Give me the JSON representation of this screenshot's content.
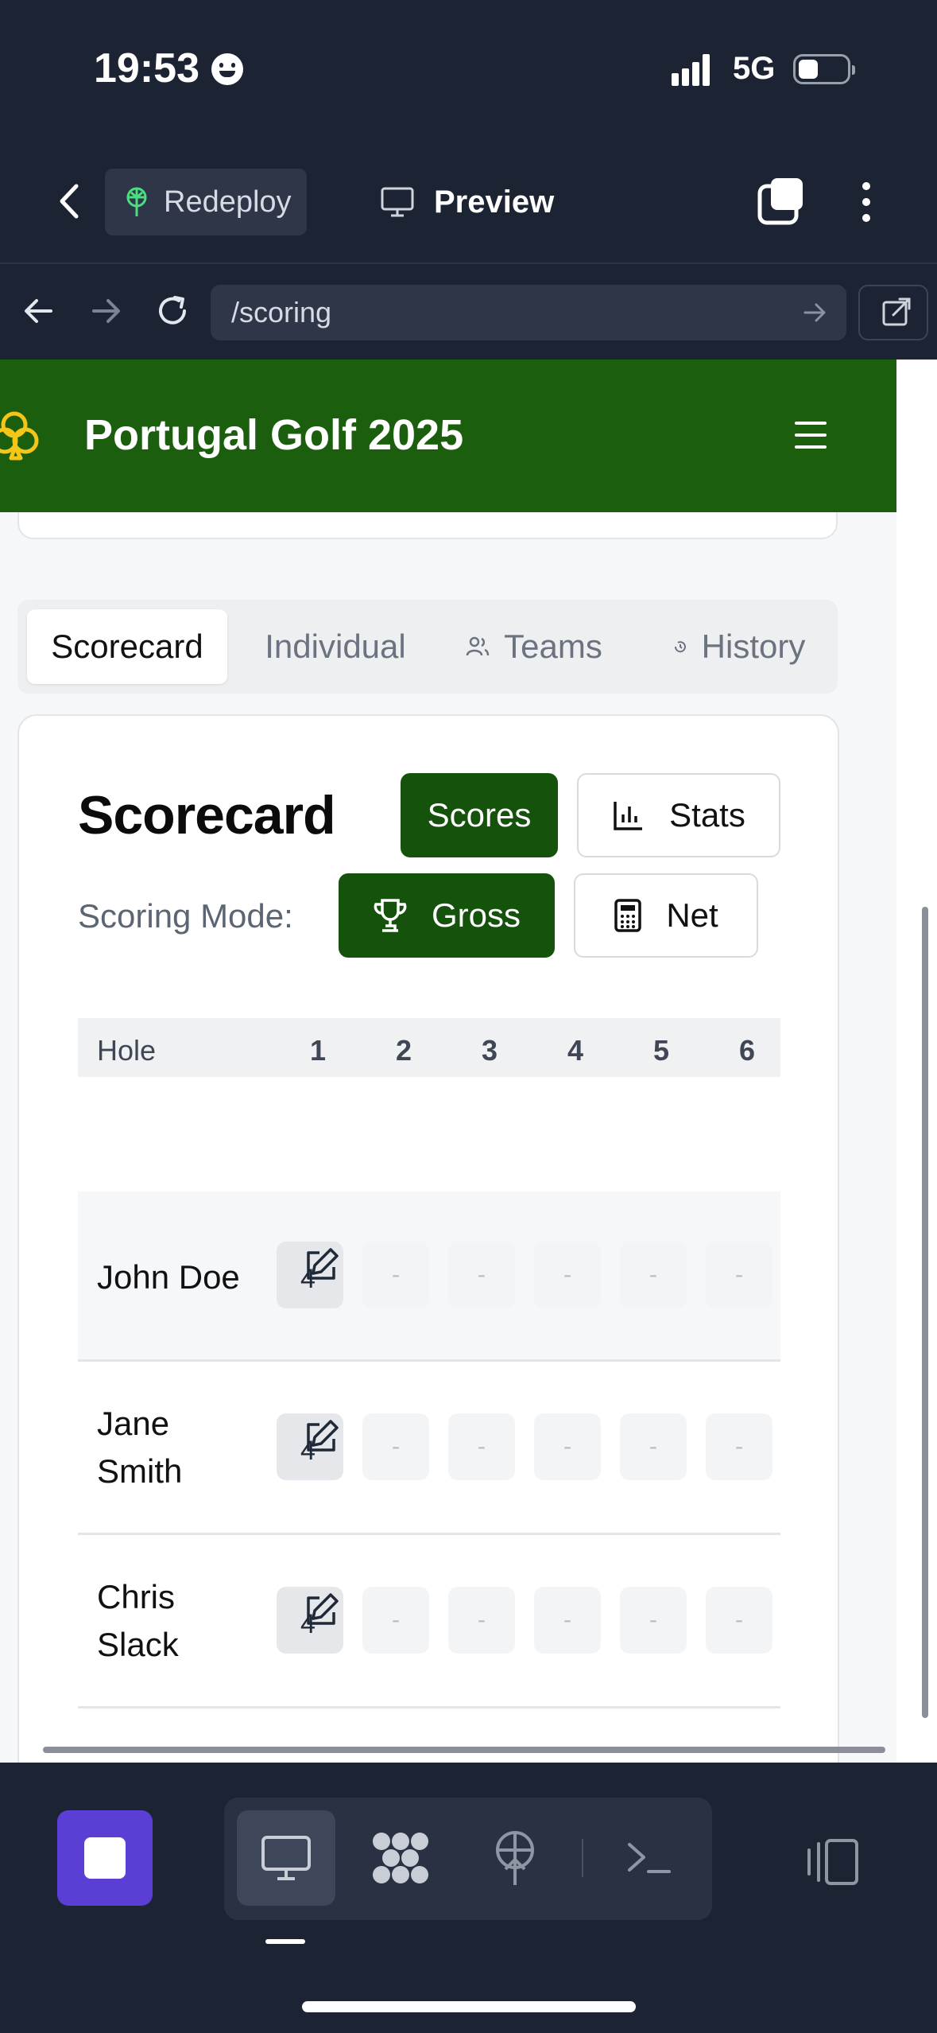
{
  "status_bar": {
    "time": "19:53",
    "network": "5G"
  },
  "app_toolbar": {
    "redeploy_label": "Redeploy",
    "preview_label": "Preview"
  },
  "url_bar": {
    "path": "/scoring"
  },
  "site": {
    "title": "Portugal Golf 2025"
  },
  "tabs": [
    {
      "label": "Scorecard",
      "active": true
    },
    {
      "label": "Individual",
      "active": false
    },
    {
      "label": "Teams",
      "active": false
    },
    {
      "label": "History",
      "active": false
    }
  ],
  "scorecard": {
    "title": "Scorecard",
    "view_buttons": {
      "scores": "Scores",
      "stats": "Stats",
      "selected": "Scores"
    },
    "scoring_mode_label": "Scoring Mode:",
    "mode_buttons": {
      "gross": "Gross",
      "net": "Net",
      "selected": "Gross"
    },
    "table": {
      "header_label": "Hole",
      "holes": [
        "1",
        "2",
        "3",
        "4",
        "5",
        "6"
      ],
      "players": [
        {
          "name": "John Doe",
          "first_score": "4",
          "scores": [
            "-",
            "-",
            "-",
            "-",
            "-"
          ]
        },
        {
          "name": "Jane Smith",
          "first_score": "4",
          "scores": [
            "-",
            "-",
            "-",
            "-",
            "-"
          ]
        },
        {
          "name": "Chris Slack",
          "first_score": "4",
          "scores": [
            "-",
            "-",
            "-",
            "-",
            "-"
          ]
        }
      ]
    }
  },
  "colors": {
    "brand_green": "#1b5e0d",
    "button_green": "#15520c",
    "dock_accent": "#5b3fd4",
    "chrome_dark": "#1c2333"
  }
}
